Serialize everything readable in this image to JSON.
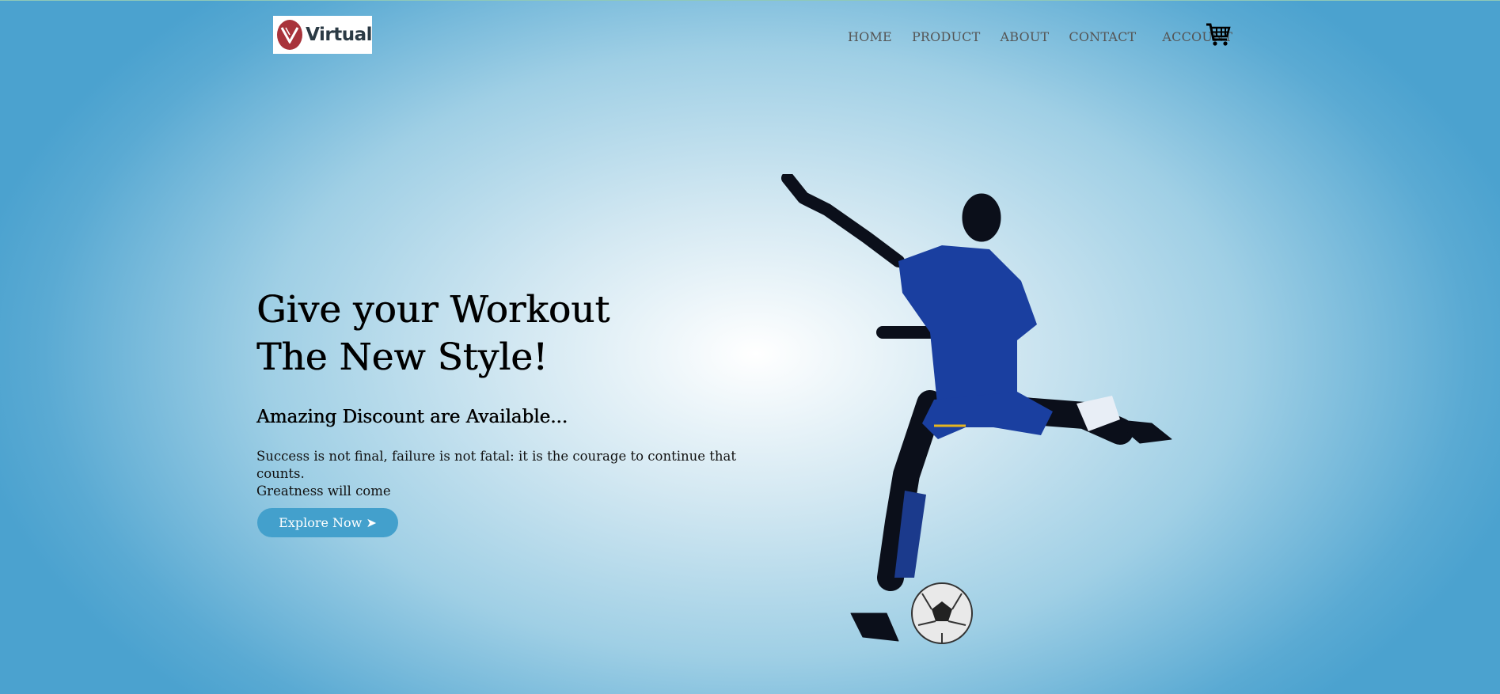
{
  "logo": {
    "text": "Virtual",
    "brand_color": "#a8333b"
  },
  "nav": {
    "items": [
      "HOME",
      "PRODUCT",
      "ABOUT",
      "CONTACT",
      "ACCOUNT"
    ],
    "cart_icon": "cart-icon"
  },
  "hero": {
    "title_line1": "Give your Workout",
    "title_line2": "The New Style!",
    "subtitle": "Amazing Discount are Available...",
    "text_line1": "Success is not final, failure is not fatal: it is the courage to continue that counts.",
    "text_line2": "Greatness will come",
    "button_label": "Explore Now ➤",
    "button_color": "#43a0cc"
  }
}
